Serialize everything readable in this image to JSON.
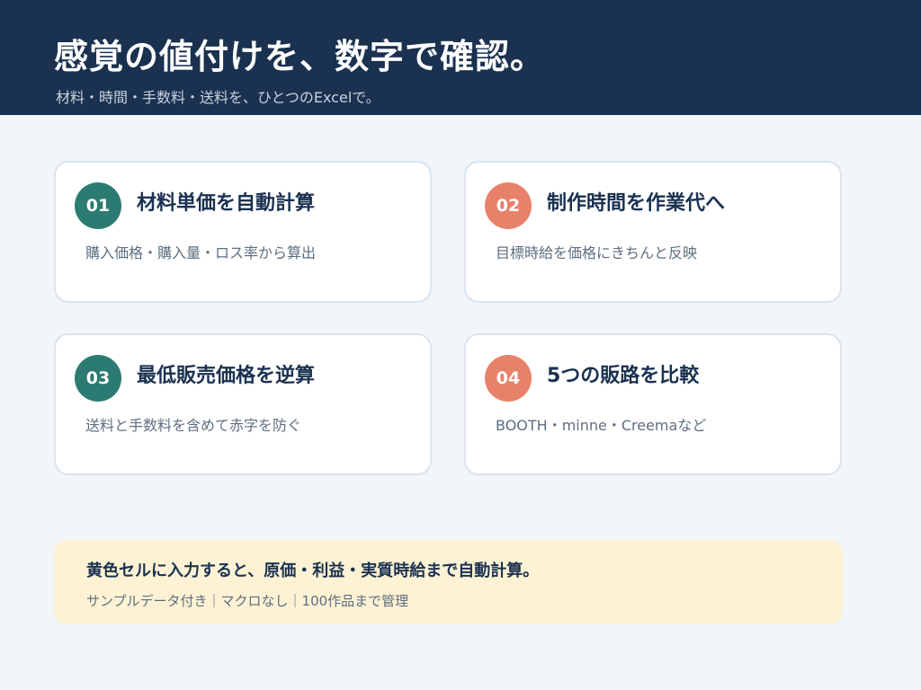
{
  "header": {
    "title": "感覚の値付けを、数字で確認。",
    "subtitle": "材料・時間・手数料・送料を、ひとつのExcelで。"
  },
  "colors": {
    "header_bg": "#1a3150",
    "badge_teal": "#2b7b72",
    "badge_coral": "#e8816a",
    "note_bg": "#fdf2d3"
  },
  "features": [
    {
      "number": "01",
      "title": "材料単価を自動計算",
      "description": "購入価格・購入量・ロス率から算出"
    },
    {
      "number": "02",
      "title": "制作時間を作業代へ",
      "description": "目標時給を価格にきちんと反映"
    },
    {
      "number": "03",
      "title": "最低販売価格を逆算",
      "description": "送料と手数料を含めて赤字を防ぐ"
    },
    {
      "number": "04",
      "title": "5つの販路を比較",
      "description": "BOOTH・minne・Creemaなど"
    }
  ],
  "note": {
    "title": "黄色セルに入力すると、原価・利益・実質時給まで自動計算。",
    "detail": "サンプルデータ付き｜マクロなし｜100作品まで管理"
  }
}
